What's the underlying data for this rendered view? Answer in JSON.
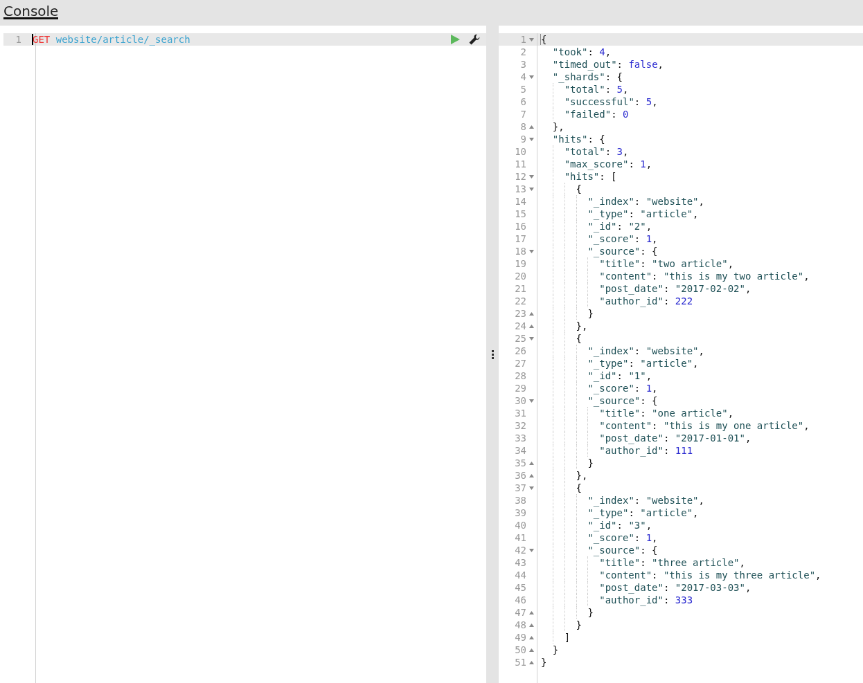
{
  "header": {
    "tabs": [
      {
        "label": "Console",
        "selected": true
      }
    ]
  },
  "request": {
    "lines": [
      {
        "number": "1",
        "method": "GET",
        "path": "website/article/_search",
        "active": true
      }
    ]
  },
  "response": {
    "lines": [
      {
        "number": "1",
        "text": "{",
        "expanded": true,
        "active": true
      },
      {
        "number": "2",
        "text": "  \"took\": 4,"
      },
      {
        "number": "3",
        "text": "  \"timed_out\": false,"
      },
      {
        "number": "4",
        "text": "  \"_shards\": {",
        "expanded": true
      },
      {
        "number": "5",
        "text": "    \"total\": 5,"
      },
      {
        "number": "6",
        "text": "    \"successful\": 5,"
      },
      {
        "number": "7",
        "text": "    \"failed\": 0"
      },
      {
        "number": "8",
        "text": "  },",
        "expanded": false
      },
      {
        "number": "9",
        "text": "  \"hits\": {",
        "expanded": true
      },
      {
        "number": "10",
        "text": "    \"total\": 3,"
      },
      {
        "number": "11",
        "text": "    \"max_score\": 1,"
      },
      {
        "number": "12",
        "text": "    \"hits\": [",
        "expanded": true
      },
      {
        "number": "13",
        "text": "      {",
        "expanded": true
      },
      {
        "number": "14",
        "text": "        \"_index\": \"website\","
      },
      {
        "number": "15",
        "text": "        \"_type\": \"article\","
      },
      {
        "number": "16",
        "text": "        \"_id\": \"2\","
      },
      {
        "number": "17",
        "text": "        \"_score\": 1,"
      },
      {
        "number": "18",
        "text": "        \"_source\": {",
        "expanded": true
      },
      {
        "number": "19",
        "text": "          \"title\": \"two article\","
      },
      {
        "number": "20",
        "text": "          \"content\": \"this is my two article\","
      },
      {
        "number": "21",
        "text": "          \"post_date\": \"2017-02-02\","
      },
      {
        "number": "22",
        "text": "          \"author_id\": 222"
      },
      {
        "number": "23",
        "text": "        }",
        "expanded": false
      },
      {
        "number": "24",
        "text": "      },",
        "expanded": false
      },
      {
        "number": "25",
        "text": "      {",
        "expanded": true
      },
      {
        "number": "26",
        "text": "        \"_index\": \"website\","
      },
      {
        "number": "27",
        "text": "        \"_type\": \"article\","
      },
      {
        "number": "28",
        "text": "        \"_id\": \"1\","
      },
      {
        "number": "29",
        "text": "        \"_score\": 1,"
      },
      {
        "number": "30",
        "text": "        \"_source\": {",
        "expanded": true
      },
      {
        "number": "31",
        "text": "          \"title\": \"one article\","
      },
      {
        "number": "32",
        "text": "          \"content\": \"this is my one article\","
      },
      {
        "number": "33",
        "text": "          \"post_date\": \"2017-01-01\","
      },
      {
        "number": "34",
        "text": "          \"author_id\": 111"
      },
      {
        "number": "35",
        "text": "        }",
        "expanded": false
      },
      {
        "number": "36",
        "text": "      },",
        "expanded": false
      },
      {
        "number": "37",
        "text": "      {",
        "expanded": true
      },
      {
        "number": "38",
        "text": "        \"_index\": \"website\","
      },
      {
        "number": "39",
        "text": "        \"_type\": \"article\","
      },
      {
        "number": "40",
        "text": "        \"_id\": \"3\","
      },
      {
        "number": "41",
        "text": "        \"_score\": 1,"
      },
      {
        "number": "42",
        "text": "        \"_source\": {",
        "expanded": true
      },
      {
        "number": "43",
        "text": "          \"title\": \"three article\","
      },
      {
        "number": "44",
        "text": "          \"content\": \"this is my three article\","
      },
      {
        "number": "45",
        "text": "          \"post_date\": \"2017-03-03\","
      },
      {
        "number": "46",
        "text": "          \"author_id\": 333"
      },
      {
        "number": "47",
        "text": "        }",
        "expanded": false
      },
      {
        "number": "48",
        "text": "      }",
        "expanded": false
      },
      {
        "number": "49",
        "text": "    ]",
        "expanded": false
      },
      {
        "number": "50",
        "text": "  }",
        "expanded": false
      },
      {
        "number": "51",
        "text": "}",
        "expanded": false
      }
    ]
  }
}
